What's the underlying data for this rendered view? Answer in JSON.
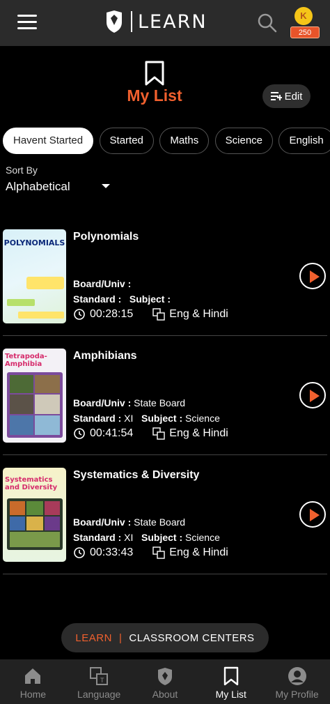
{
  "header": {
    "logo_text": "LEARN",
    "coins": "250",
    "coin_letter": "K"
  },
  "page": {
    "title": "My List",
    "edit_label": "Edit"
  },
  "filters": [
    "Havent Started",
    "Started",
    "Maths",
    "Science",
    "English"
  ],
  "sort": {
    "label": "Sort By",
    "value": "Alphabetical"
  },
  "items": [
    {
      "title": "Polynomials",
      "board_label": "Board/Univ :",
      "board": "",
      "standard_label": "Standard :",
      "standard": "",
      "subject_label": "Subject :",
      "subject": "",
      "duration": "00:28:15",
      "language": "Eng & Hindi",
      "thumb_text": "POLYNOMIALS"
    },
    {
      "title": "Amphibians",
      "board_label": "Board/Univ :",
      "board": "State Board",
      "standard_label": "Standard :",
      "standard": "XI",
      "subject_label": "Subject :",
      "subject": "Science",
      "duration": "00:41:54",
      "language": "Eng & Hindi",
      "thumb_text": "Tetrapoda-Amphibia"
    },
    {
      "title": "Systematics & Diversity",
      "board_label": "Board/Univ :",
      "board": "State Board",
      "standard_label": "Standard :",
      "standard": "XI",
      "subject_label": "Subject :",
      "subject": "Science",
      "duration": "00:33:43",
      "language": "Eng & Hindi",
      "thumb_text": "Systematics and Diversity"
    }
  ],
  "learn_bar": {
    "learn": "LEARN",
    "separator": "|",
    "centers": "CLASSROOM CENTERS"
  },
  "nav": [
    {
      "label": "Home",
      "icon": "home-icon"
    },
    {
      "label": "Language",
      "icon": "language-icon"
    },
    {
      "label": "About",
      "icon": "about-icon"
    },
    {
      "label": "My List",
      "icon": "bookmark-icon"
    },
    {
      "label": "My Profile",
      "icon": "profile-icon"
    }
  ],
  "colors": {
    "accent": "#f0602e",
    "header_bg": "#2b2b2b",
    "background": "#000000"
  }
}
